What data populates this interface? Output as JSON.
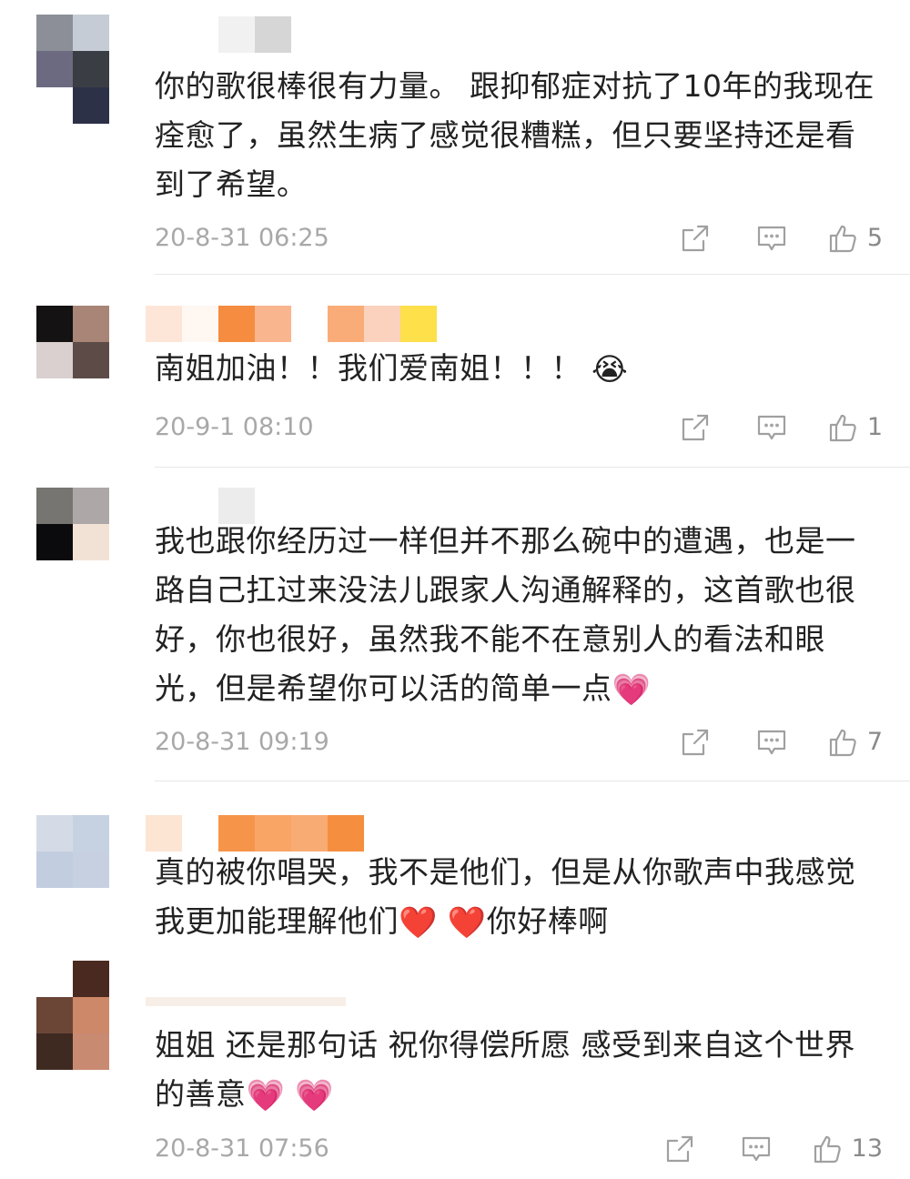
{
  "comments": [
    {
      "text": "你的歌很棒很有力量。 跟抑郁症对抗了10年的我现在痊愈了，虽然生病了感觉很糟糕，但只要坚持还是看到了希望。",
      "timestamp": "20-8-31 06:25",
      "likes": "5",
      "emoji": ""
    },
    {
      "text": "南姐加油！！我们爱南姐！！！",
      "timestamp": "20-9-1 08:10",
      "likes": "1",
      "emoji": "😭"
    },
    {
      "text": "我也跟你经历过一样但并不那么碗中的遭遇，也是一路自己扛过来没法儿跟家人沟通解释的，这首歌也很好，你也很好，虽然我不能不在意别人的看法和眼光，但是希望你可以活的简单一点",
      "timestamp": "20-8-31 09:19",
      "likes": "7",
      "emoji": "💗"
    },
    {
      "text": "真的被你唱哭，我不是他们，但是从你歌声中我感觉我更加能理解他们",
      "text_tail": "你好棒啊",
      "emoji": "❤️",
      "timestamp": "",
      "likes": ""
    },
    {
      "text": "姐姐 还是那句话 祝你得偿所愿 感受到来自这个世界的善意",
      "timestamp": "20-8-31 07:56",
      "likes": "13",
      "emoji": "💗"
    }
  ],
  "icons": {
    "share": "share-icon",
    "reply": "comment-icon",
    "like": "thumbs-up-icon"
  },
  "colors": {
    "timestamp": "#a8a8a8",
    "icon": "#a0a0a0",
    "divider": "#e8e8e8"
  }
}
